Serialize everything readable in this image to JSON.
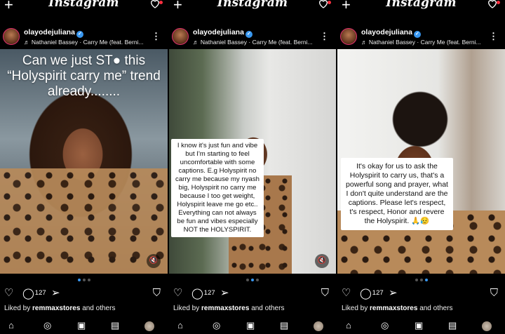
{
  "brand": "Instagram",
  "post": {
    "username": "olayodejuliana",
    "verified_glyph": "✓",
    "music": "Nathaniel Bassey · Carry Me (feat. Berni...",
    "comments": "127",
    "liked_prefix": "Liked by",
    "liked_user": "remmaxstores",
    "liked_suffix": "and others"
  },
  "panels": [
    {
      "overlay": "Can we just ST● this “Holyspirit carry me” trend already........",
      "active_dot": 0
    },
    {
      "note": "I know it's just fun and vibe but I'm starting to feel uncomfortable with some captions. E.g Holyspirit no carry me because my nyash big, Holyspirit no carry me because I too get weight, Holyspirit leave me go etc.. Everything can not always be fun and vibes especially NOT the HOLYSPIRIT.",
      "active_dot": 1
    },
    {
      "note": "It's okay for us to ask the Holyspirit to carry us, that's a powerful song and prayer, what I don't quite understand are the captions. Please let's respect, t's respect, Honor and revere the Holyspirit. 🙏😥",
      "active_dot": 2
    }
  ],
  "icons": {
    "plus": "+",
    "kebab": "⋮",
    "music": "♬",
    "heart": "♡",
    "comment": "◯",
    "share": "➢",
    "save": "⛉",
    "mute": "🔇",
    "home": "⌂",
    "explore": "◎",
    "reels": "▣",
    "shop": "▤"
  },
  "colors": {
    "background": "#000000",
    "verified": "#3897f0",
    "notification": "#ff3040",
    "active_dot": "#3897f0"
  }
}
